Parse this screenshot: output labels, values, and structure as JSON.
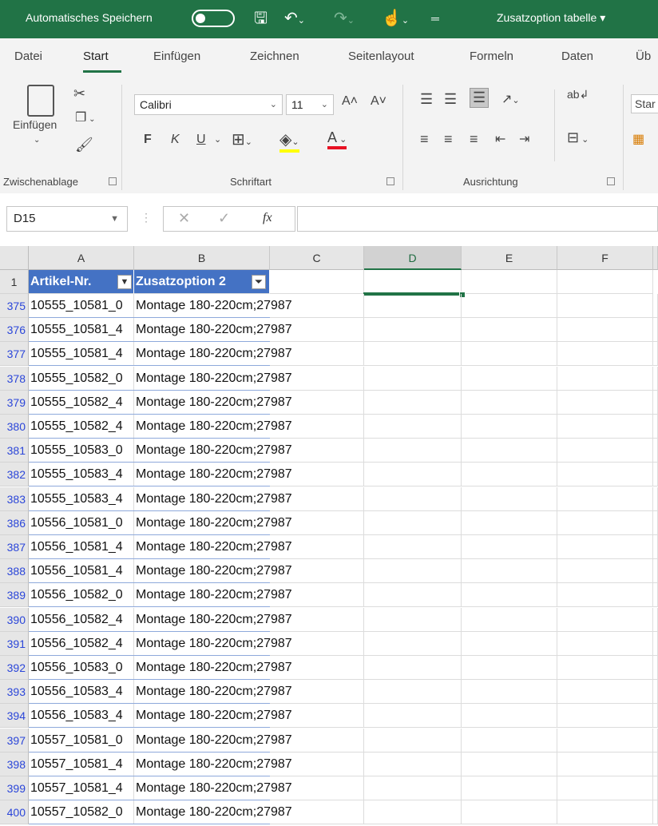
{
  "titlebar": {
    "autosave_label": "Automatisches Speichern",
    "doc_title": "Zusatzoption tabelle",
    "doc_title_arrow": "▾"
  },
  "tabs": [
    "Datei",
    "Start",
    "Einfügen",
    "Zeichnen",
    "Seitenlayout",
    "Formeln",
    "Daten",
    "Üb"
  ],
  "ribbon": {
    "clipboard_group": "Zwischenablage",
    "paste_label": "Einfügen",
    "font_group": "Schriftart",
    "font_name": "Calibri",
    "font_size": "11",
    "bold": "F",
    "italic": "K",
    "underline": "U",
    "alignment_group": "Ausrichtung",
    "styles_label": "Star"
  },
  "formula_bar": {
    "name_box": "D15",
    "fx": "fx",
    "formula": ""
  },
  "grid": {
    "columns": [
      "A",
      "B",
      "C",
      "D",
      "E",
      "F"
    ],
    "header_row_number": "1",
    "header_a": "Artikel-Nr.",
    "header_b": "Zusatzoption 2",
    "rows": [
      {
        "n": "375",
        "a": "10555_10581_0",
        "b": "Montage 180-220cm;27987"
      },
      {
        "n": "376",
        "a": "10555_10581_4",
        "b": "Montage 180-220cm;27987"
      },
      {
        "n": "377",
        "a": "10555_10581_4",
        "b": "Montage 180-220cm;27987"
      },
      {
        "n": "378",
        "a": "10555_10582_0",
        "b": "Montage 180-220cm;27987"
      },
      {
        "n": "379",
        "a": "10555_10582_4",
        "b": "Montage 180-220cm;27987"
      },
      {
        "n": "380",
        "a": "10555_10582_4",
        "b": "Montage 180-220cm;27987"
      },
      {
        "n": "381",
        "a": "10555_10583_0",
        "b": "Montage 180-220cm;27987"
      },
      {
        "n": "382",
        "a": "10555_10583_4",
        "b": "Montage 180-220cm;27987"
      },
      {
        "n": "383",
        "a": "10555_10583_4",
        "b": "Montage 180-220cm;27987"
      },
      {
        "n": "386",
        "a": "10556_10581_0",
        "b": "Montage 180-220cm;27987"
      },
      {
        "n": "387",
        "a": "10556_10581_4",
        "b": "Montage 180-220cm;27987"
      },
      {
        "n": "388",
        "a": "10556_10581_4",
        "b": "Montage 180-220cm;27987"
      },
      {
        "n": "389",
        "a": "10556_10582_0",
        "b": "Montage 180-220cm;27987"
      },
      {
        "n": "390",
        "a": "10556_10582_4",
        "b": "Montage 180-220cm;27987"
      },
      {
        "n": "391",
        "a": "10556_10582_4",
        "b": "Montage 180-220cm;27987"
      },
      {
        "n": "392",
        "a": "10556_10583_0",
        "b": "Montage 180-220cm;27987"
      },
      {
        "n": "393",
        "a": "10556_10583_4",
        "b": "Montage 180-220cm;27987"
      },
      {
        "n": "394",
        "a": "10556_10583_4",
        "b": "Montage 180-220cm;27987"
      },
      {
        "n": "397",
        "a": "10557_10581_0",
        "b": "Montage 180-220cm;27987"
      },
      {
        "n": "398",
        "a": "10557_10581_4",
        "b": "Montage 180-220cm;27987"
      },
      {
        "n": "399",
        "a": "10557_10581_4",
        "b": "Montage 180-220cm;27987"
      },
      {
        "n": "400",
        "a": "10557_10582_0",
        "b": "Montage 180-220cm;27987"
      }
    ]
  },
  "colors": {
    "accent": "#217346",
    "table_header": "#4472c4",
    "row_number_filtered": "#2b46d9"
  }
}
